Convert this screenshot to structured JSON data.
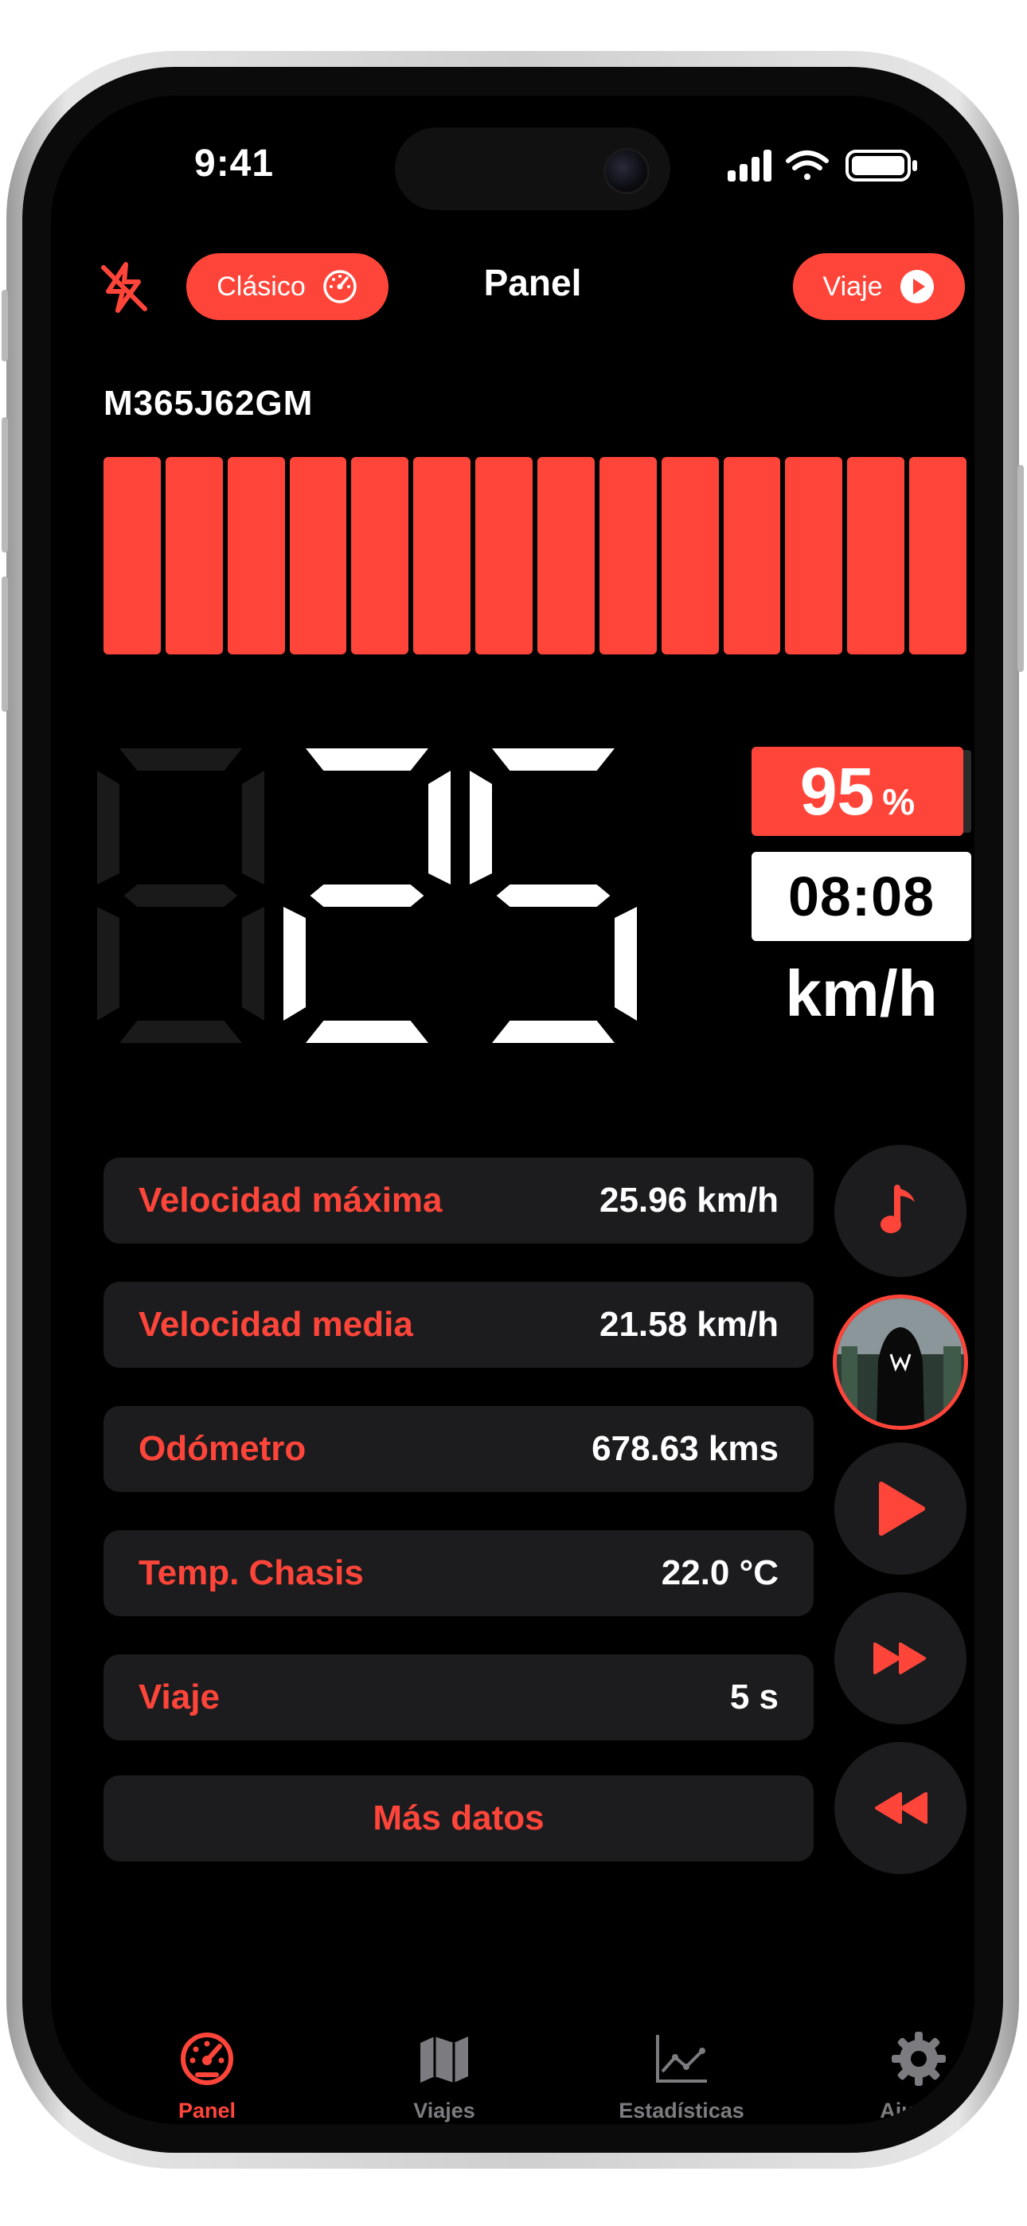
{
  "status_bar": {
    "time": "9:41"
  },
  "header": {
    "mode_label": "Clásico",
    "title": "Panel",
    "trip_label": "Viaje"
  },
  "device": {
    "serial": "M365J62GM"
  },
  "battery": {
    "segments_filled": 14,
    "segments_total": 14,
    "percent_value": "95",
    "percent_sign": "%"
  },
  "speed": {
    "display": "025",
    "leading_digit_dim": "0",
    "value": "25",
    "unit": "km/h"
  },
  "clock": "08:08",
  "stats": [
    {
      "label": "Velocidad máxima",
      "value": "25.96 km/h"
    },
    {
      "label": "Velocidad media",
      "value": "21.58 km/h"
    },
    {
      "label": "Odómetro",
      "value": "678.63 kms"
    },
    {
      "label": "Temp. Chasis",
      "value": "22.0 °C"
    },
    {
      "label": "Viaje",
      "value": "5 s"
    }
  ],
  "more_button": "Más datos",
  "media": [
    "music-note-icon",
    "album-art",
    "play-icon",
    "fast-forward-icon",
    "rewind-icon"
  ],
  "tabs": [
    {
      "label": "Panel",
      "icon": "speedometer-icon",
      "active": true
    },
    {
      "label": "Viajes",
      "icon": "map-icon",
      "active": false
    },
    {
      "label": "Estadísticas",
      "icon": "chart-icon",
      "active": false
    },
    {
      "label": "Ajustes",
      "icon": "gear-icon",
      "active": false
    }
  ],
  "colors": {
    "accent": "#ff453a",
    "card": "#1c1c1e",
    "background": "#000000",
    "inactive": "#7c7c80"
  }
}
